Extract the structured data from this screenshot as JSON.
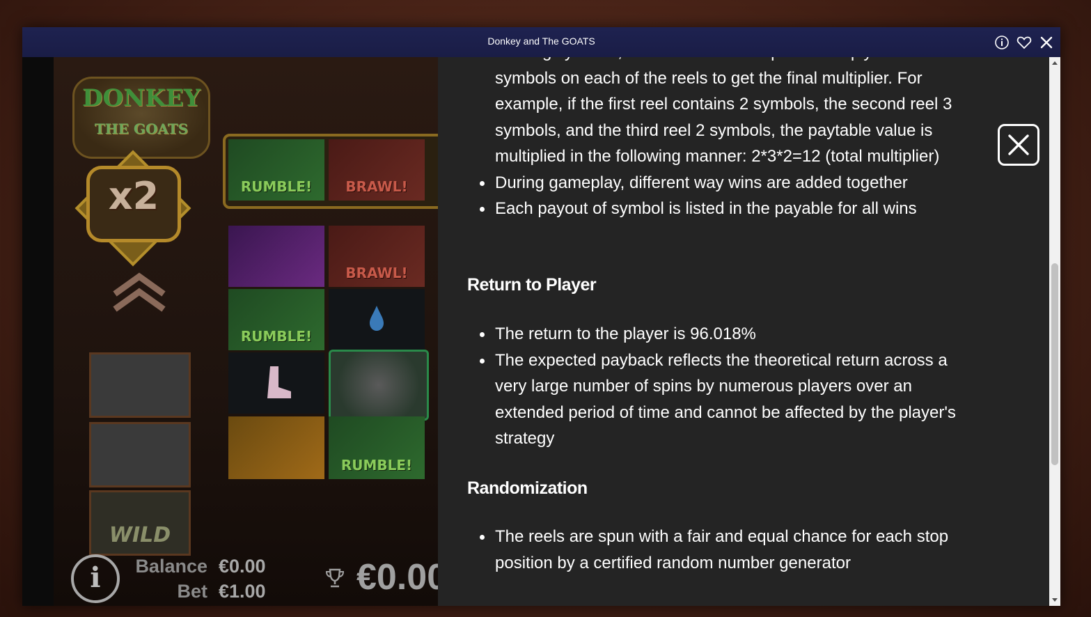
{
  "window": {
    "title": "Donkey and The GOATS",
    "icons": [
      "info-icon",
      "heart-icon",
      "close-icon"
    ]
  },
  "game": {
    "logo_line1": "DONKEY",
    "logo_line2": "THE GOATS",
    "multiplier": "x2",
    "wild_label": "WILD",
    "reel_labels": {
      "rumble": "RUMBLE!",
      "brawl": "BRAWL!"
    },
    "balance_label": "Balance",
    "balance_value": "€0.00",
    "bet_label": "Bet",
    "bet_value": "€1.00",
    "win_value": "€0.00"
  },
  "rules": {
    "intro_items": [
      "winning symbols, the win will be multiplied. Multiply the number of symbols on each of the reels to get the final multiplier. For example, if the first reel contains 2 symbols, the second reel 3 symbols, and the third reel 2 symbols, the paytable value is multiplied in the following manner: 2*3*2=12 (total multiplier)",
      "During gameplay, different way wins are added together",
      "Each payout of symbol is listed in the payable for all wins"
    ],
    "rtp_title": "Return to Player",
    "rtp_items": [
      "The return to the player is 96.018%",
      "The expected payback reflects the theoretical return across a very large number of spins by numerous players over an extended period of time and cannot be affected by the player's strategy"
    ],
    "random_title": "Randomization",
    "random_items": [
      "The reels are spun with a fair and equal chance for each stop position by a certified random number generator"
    ]
  },
  "colors": {
    "titlebar": "#1e2250",
    "panel": "#242424",
    "text": "#ffffff"
  }
}
